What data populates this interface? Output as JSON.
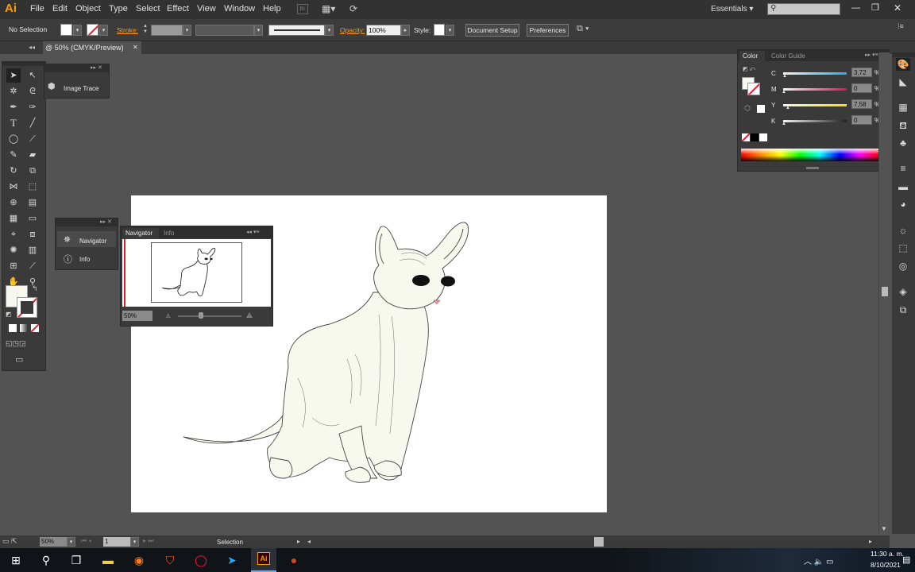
{
  "app": {
    "logo": "Ai"
  },
  "menu": [
    "File",
    "Edit",
    "Object",
    "Type",
    "Select",
    "Effect",
    "View",
    "Window",
    "Help"
  ],
  "workspace": {
    "label": "Essentials",
    "arrow": "▾"
  },
  "search": {
    "placeholder": ""
  },
  "window_controls": {
    "minimize": "—",
    "restore": "❐",
    "close": "✕"
  },
  "controlbar": {
    "selection": "No Selection",
    "stroke_label": "Stroke:",
    "opacity_label": "Opacity:",
    "opacity_value": "100%",
    "style_label": "Style:",
    "doc_setup": "Document Setup",
    "preferences": "Preferences"
  },
  "document_tab": {
    "title": "@ 50% (CMYK/Preview)",
    "close": "✕"
  },
  "panels": {
    "image_trace": {
      "label": "Image Trace"
    },
    "navigator_dock": {
      "navigator": "Navigator",
      "info": "Info"
    },
    "navigator": {
      "tab1": "Navigator",
      "tab2": "Info",
      "zoom": "50%"
    },
    "color": {
      "tab1": "Color",
      "tab2": "Color Guide",
      "channels": [
        {
          "label": "C",
          "value": "3,72",
          "unit": "%",
          "level": 0.04,
          "color": "#29abe2"
        },
        {
          "label": "M",
          "value": "0",
          "unit": "%",
          "level": 0.0,
          "color": "#d4145a"
        },
        {
          "label": "Y",
          "value": "7,58",
          "unit": "%",
          "level": 0.08,
          "color": "#f4e10b"
        },
        {
          "label": "K",
          "value": "0",
          "unit": "%",
          "level": 0.0,
          "color": "#888888"
        }
      ]
    }
  },
  "statusbar": {
    "zoom": "50%",
    "artboard": "1",
    "tool": "Selection"
  },
  "taskbar": {
    "time": "11:30 a. m.",
    "date": "8/10/2021"
  }
}
